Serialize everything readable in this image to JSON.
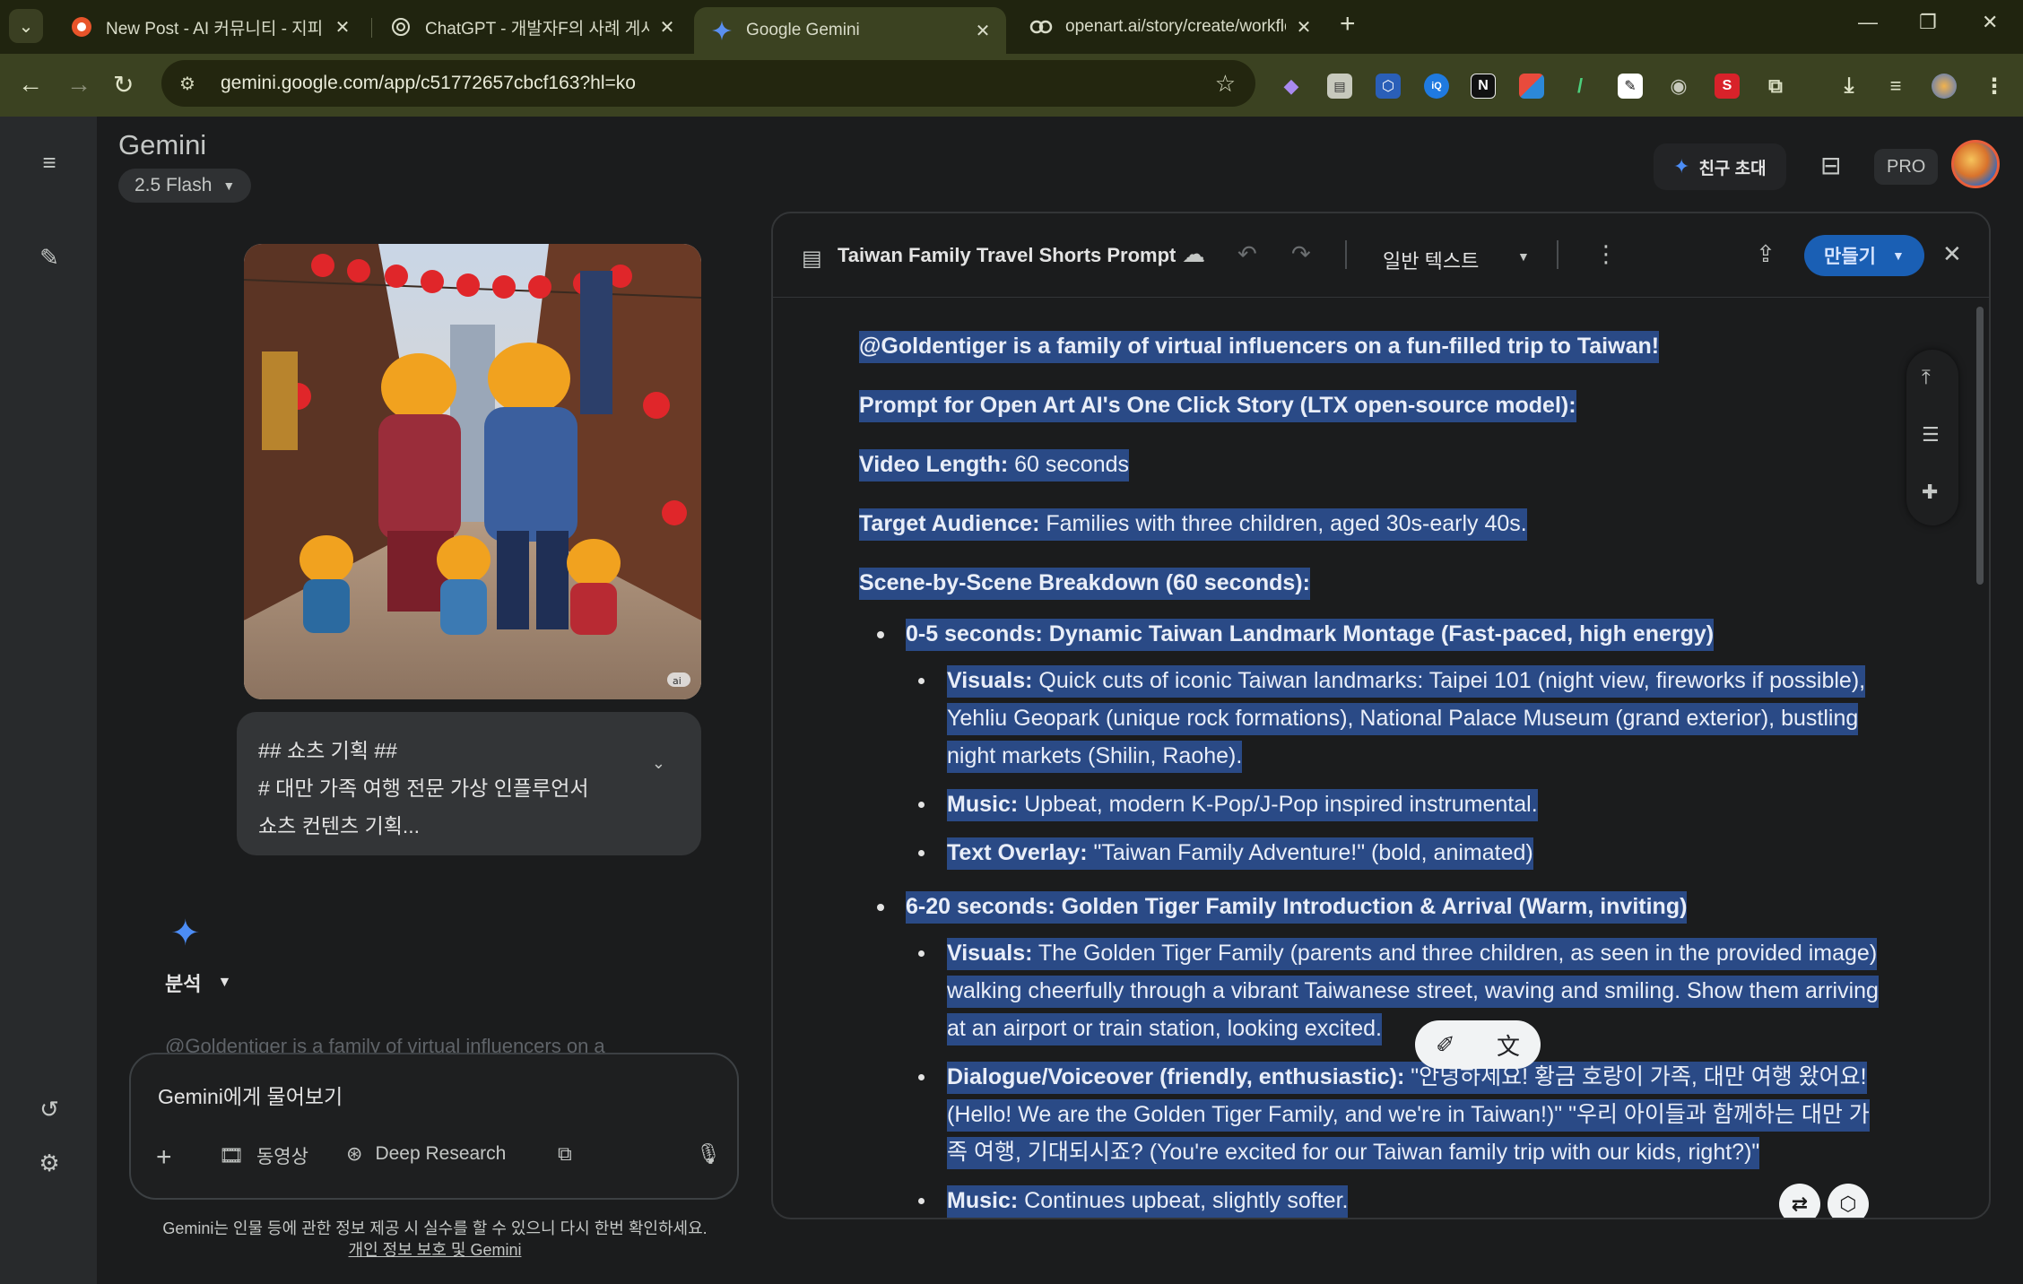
{
  "browser": {
    "tabs": [
      {
        "title": "New Post - AI 커뮤니티 - 지피",
        "active": false
      },
      {
        "title": "ChatGPT - 개발자F의 사례 게시",
        "active": false
      },
      {
        "title": "Google Gemini",
        "active": true
      },
      {
        "title": "openart.ai/story/create/workflow",
        "active": false
      }
    ],
    "url": "gemini.google.com/app/c51772657cbcf163?hl=ko",
    "extensions": [
      "N",
      "S"
    ]
  },
  "gemini": {
    "title": "Gemini",
    "model": "2.5 Flash",
    "invite_label": "친구 초대",
    "pro_label": "PRO",
    "prompt_lines": [
      "## 쇼츠 기획 ##",
      "# 대만 가족 여행 전문 가상 인플루언서",
      "쇼츠 컨텐츠 기획..."
    ],
    "analysis_label": "분석",
    "faded_response": "@Goldentiger is a family of virtual influencers on a",
    "input_placeholder": "Gemini에게 물어보기",
    "tools": {
      "video": "동영상",
      "deep_research": "Deep Research"
    },
    "disclaimer": "Gemini는 인물 등에 관한 정보 제공 시 실수를 할 수 있으니 다시 한번 확인하세요.",
    "privacy_link": "개인 정보 보호 및 Gemini",
    "image_badge": "ai"
  },
  "canvas": {
    "title": "Taiwan Family Travel Shorts Prompt",
    "text_style": "일반 텍스트",
    "make_label": "만들기",
    "p1": "@Goldentiger is a family of virtual influencers on a fun-filled trip to Taiwan!",
    "p2": "Prompt for Open Art AI's One Click Story (LTX open-source model):",
    "video_length_label": "Video Length:",
    "video_length_value": " 60 seconds",
    "audience_label": "Target Audience:",
    "audience_value": " Families with three children, aged 30s-early 40s.",
    "breakdown": "Scene-by-Scene Breakdown (60 seconds):",
    "s1_title": "0-5 seconds: Dynamic Taiwan Landmark Montage (Fast-paced, high energy)",
    "s1_visuals_label": "Visuals:",
    "s1_visuals": " Quick cuts of iconic Taiwan landmarks: Taipei 101 (night view, fireworks if possible), Yehliu Geopark (unique rock formations), National Palace Museum (grand exterior), bustling night markets (Shilin, Raohe).",
    "s1_music_label": "Music:",
    "s1_music": " Upbeat, modern K-Pop/J-Pop inspired instrumental.",
    "s1_overlay_label": "Text Overlay:",
    "s1_overlay": " \"Taiwan Family Adventure!\" (bold, animated)",
    "s2_title": "6-20 seconds: Golden Tiger Family Introduction & Arrival (Warm, inviting)",
    "s2_visuals_label": "Visuals:",
    "s2_visuals": " The Golden Tiger Family (parents and three children, as seen in the provided image) walking cheerfully through a vibrant Taiwanese street, waving and smiling. Show them arriving at an airport or train station, looking excited.",
    "s2_dialogue_label": "Dialogue/Voiceover (friendly, enthusiastic):",
    "s2_dialogue": " \"안녕하세요! 황금 호랑이 가족, 대만 여행 왔어요! (Hello! We are the Golden Tiger Family, and we're in Taiwan!)\" \"우리 아이들과 함께하는 대만 가족 여행, 기대되시죠? (You're excited for our Taiwan family trip with our kids, right?)\"",
    "s2_music_label": "Music:",
    "s2_music": " Continues upbeat, slightly softer."
  },
  "icons": {
    "menu": "hamburger-icon",
    "new_chat": "edit-icon",
    "history": "history-icon",
    "settings": "gear-icon"
  },
  "colors": {
    "selection": "#2a4a86",
    "accent": "#1a5fb4",
    "gemini_blue": "#4c8df6"
  }
}
